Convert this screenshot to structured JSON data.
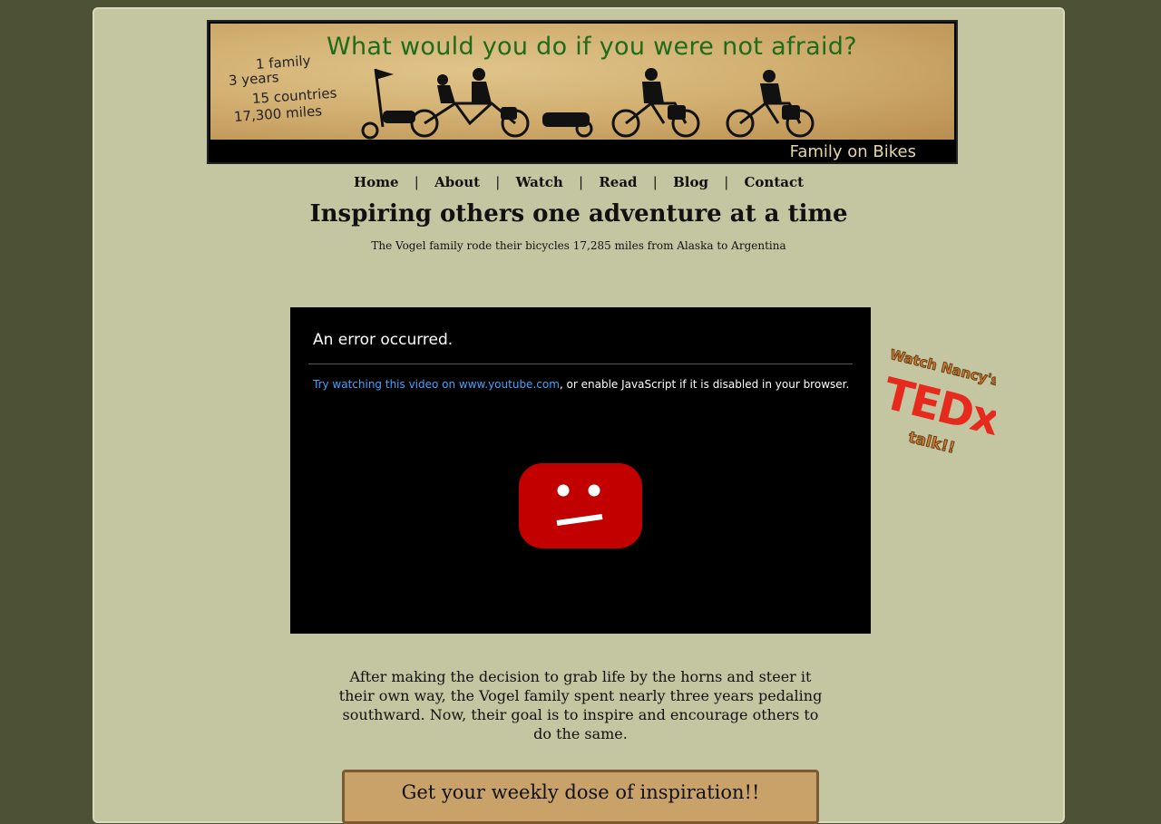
{
  "banner": {
    "tagline": "What would you do if you were not afraid?",
    "stats": [
      "1 family",
      "3 years",
      "15 countries",
      "17,300 miles"
    ],
    "brand": "Family on Bikes"
  },
  "nav": {
    "items": [
      {
        "label": "Home"
      },
      {
        "label": "About"
      },
      {
        "label": "Watch"
      },
      {
        "label": "Read"
      },
      {
        "label": "Blog"
      },
      {
        "label": "Contact"
      }
    ],
    "separator": "|"
  },
  "hero": {
    "title": "Inspiring others one adventure at a time",
    "subtitle": "The Vogel family rode their bicycles 17,285 miles from Alaska to Argentina"
  },
  "video": {
    "error_title": "An error occurred.",
    "link_text": "Try watching this video on www.youtube.com",
    "message_rest": ", or enable JavaScript if it is disabled in your browser."
  },
  "tedx_badge": {
    "top_text": "Watch Nancy's",
    "brand": "TEDx",
    "bottom_text": "talk!!"
  },
  "description": "After making the decision to grab life by the horns and steer it their own way, the Vogel family spent nearly three years pedaling southward. Now, their goal is to inspire and encourage others to do the same.",
  "newsletter": {
    "title": "Get your weekly dose of inspiration!!"
  },
  "colors": {
    "page_bg": "#4e5235",
    "content_bg": "#c4c6a1",
    "tagline_green": "#1f6b1a",
    "link_blue": "#3ea6ff",
    "youtube_red": "#cc0000",
    "tedx_red": "#e62b1e"
  }
}
